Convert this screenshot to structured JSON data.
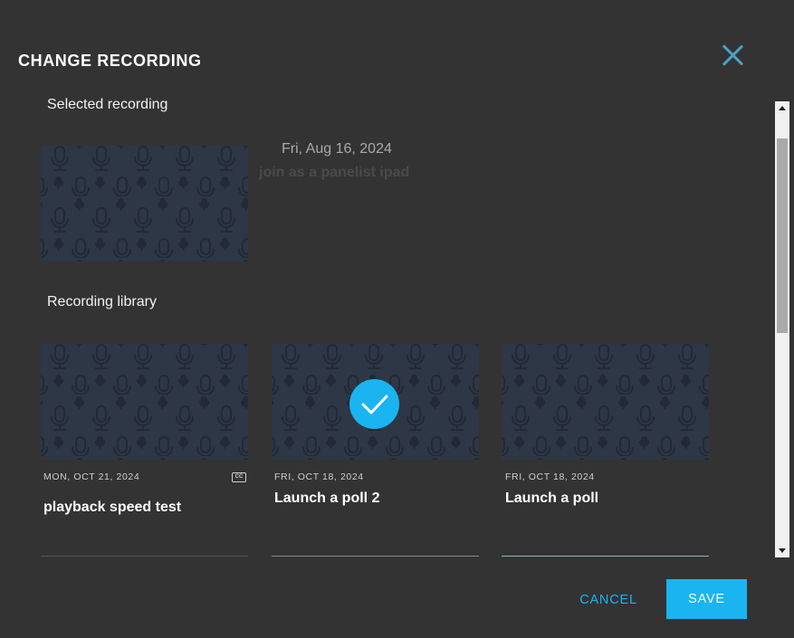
{
  "dialog": {
    "title": "CHANGE RECORDING",
    "close_icon": "close-icon"
  },
  "selected": {
    "section_label": "Selected recording",
    "date": "Fri, Aug 16, 2024",
    "name": "join as a panelist ipad"
  },
  "library": {
    "section_label": "Recording library",
    "cards": [
      {
        "date": "MON, OCT 21, 2024",
        "title": "playback speed test",
        "has_captions": true,
        "cc_label": "CC",
        "selected": false
      },
      {
        "date": "FRI, OCT 18, 2024",
        "title": "Launch a poll 2",
        "has_captions": false,
        "selected": true
      },
      {
        "date": "FRI, OCT 18, 2024",
        "title": "Launch a poll",
        "has_captions": false,
        "selected": false
      }
    ]
  },
  "footer": {
    "cancel_label": "CANCEL",
    "save_label": "SAVE"
  },
  "colors": {
    "background": "#333333",
    "accent": "#1ab4f0",
    "thumbnail": "#2e3746",
    "close_icon": "#4aa3c4"
  }
}
